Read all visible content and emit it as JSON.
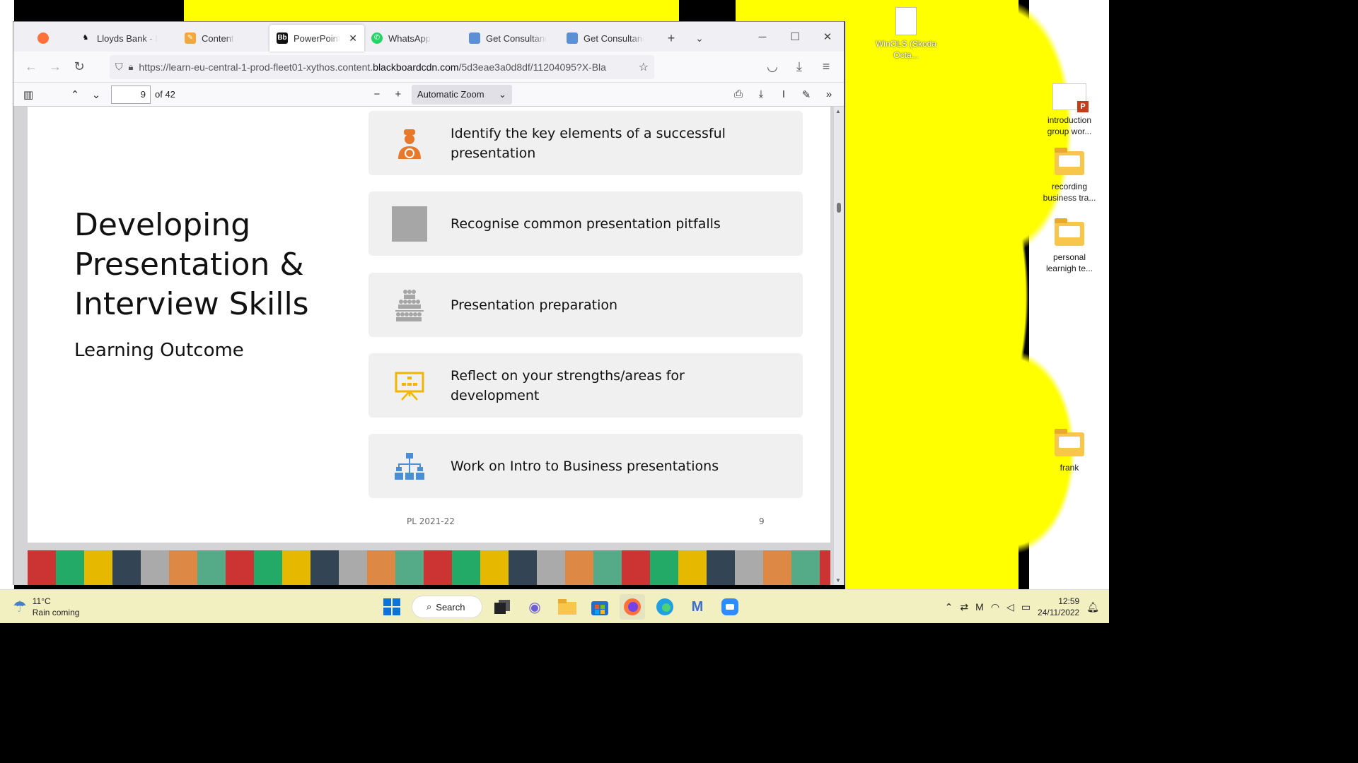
{
  "desktop": {
    "icons": [
      {
        "label": "WinOLS (Skoda Octa..."
      },
      {
        "label": "introduction group wor..."
      },
      {
        "label": "recording business tra..."
      },
      {
        "label": "personal learnigh te..."
      },
      {
        "label": "frank"
      }
    ]
  },
  "browser": {
    "tabs": [
      {
        "label": ""
      },
      {
        "label": "Lloyds Bank - Log"
      },
      {
        "label": "Content"
      },
      {
        "label": "PowerPoint Pre"
      },
      {
        "label": "WhatsApp"
      },
      {
        "label": "Get Consultancy"
      },
      {
        "label": "Get Consultancy"
      }
    ],
    "url_prefix": "https://learn-eu-central-1-prod-fleet01-xythos.content.",
    "url_host": "blackboardcdn.com",
    "url_suffix": "/5d3eae3a0d8df/11204095?X-Bla"
  },
  "pdf": {
    "page_current": "9",
    "page_total": "of 42",
    "zoom": "Automatic Zoom"
  },
  "slide": {
    "title": "Developing Presentation & Interview Skills",
    "subtitle": "Learning Outcome",
    "items": [
      "Identify the key elements of a successful presentation",
      "Recognise common presentation pitfalls",
      "Presentation preparation",
      "Reflect on your strengths/areas for development",
      "Work on Intro to Business presentations"
    ],
    "footer_left": "PL 2021-22",
    "footer_right": "9"
  },
  "taskbar": {
    "temperature": "11°C",
    "weather": "Rain coming",
    "search": "Search",
    "time": "12:59",
    "date": "24/11/2022"
  },
  "colors": {
    "wallpaper_yellow": "#ffff00",
    "icon_orange": "#e8792b",
    "icon_gray": "#a6a6a6",
    "icon_gold": "#f2b600",
    "icon_blue": "#4a8fd6"
  }
}
